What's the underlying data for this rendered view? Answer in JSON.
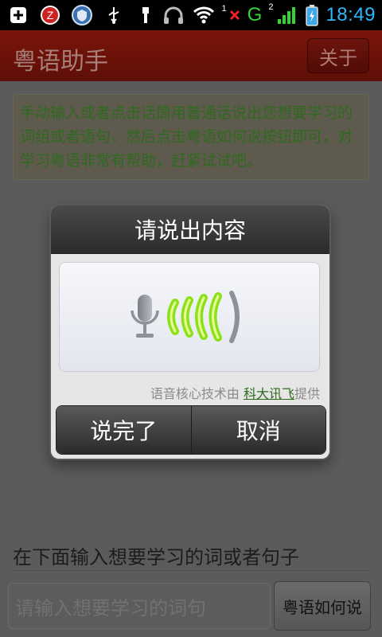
{
  "status_bar": {
    "time": "18:49",
    "network_type": "G",
    "signal_badge": "2",
    "missed_badge": "1",
    "icons": [
      "add-icon",
      "zone-icon",
      "shield-app-icon",
      "usb-icon",
      "usb-debug-icon",
      "headphones-icon",
      "wifi-icon",
      "signal-icon",
      "battery-icon"
    ]
  },
  "app": {
    "title": "粤语助手",
    "about_label": "关于"
  },
  "main": {
    "hint": "手动输入或者点击话筒用普通话说出您想要学习的词组或者语句，然后点击粤语如何说按钮即可，对学习粤语非常有帮助，赶紧试试吧。",
    "section_label": "在下面输入想要学习的词或者句子",
    "input_placeholder": "请输入想要学习的词句",
    "speak_button": "粤语如何说"
  },
  "dialog": {
    "title": "请说出内容",
    "powered_prefix": "语音核心技术由 ",
    "powered_link": "科大讯飞",
    "powered_suffix": "提供",
    "done_button": "说完了",
    "cancel_button": "取消"
  },
  "colors": {
    "accent_time": "#2fb6ff",
    "title_bar": "#7a150a",
    "hint_text": "#2e6a1e",
    "mic_wave": "#9ee52a"
  }
}
